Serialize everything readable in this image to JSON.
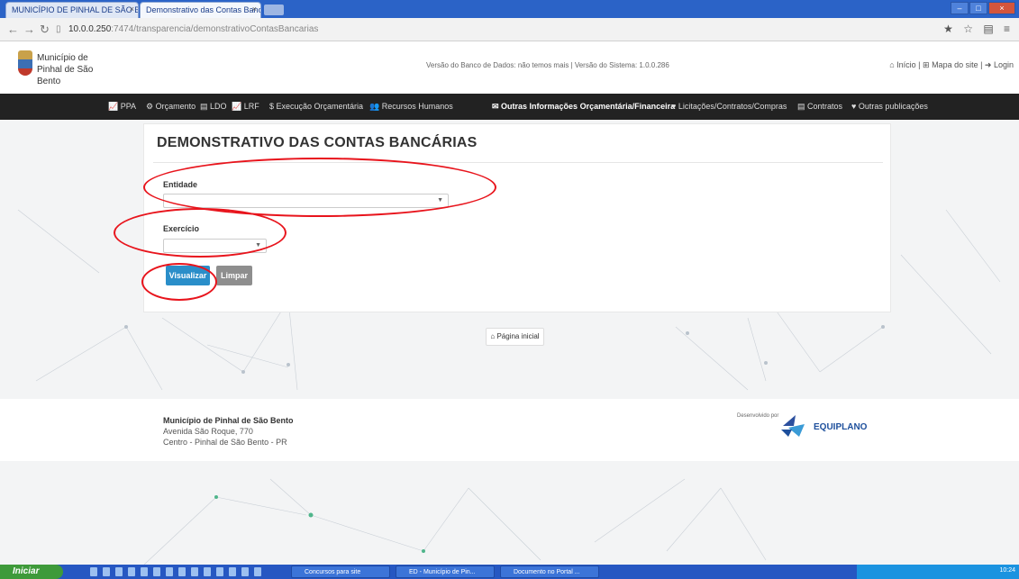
{
  "browser": {
    "tabs": [
      {
        "label": "MUNICÍPIO DE PINHAL DE SÃO BENTO"
      },
      {
        "label": "Demonstrativo das Contas Bancárias"
      }
    ],
    "url_host": "10.0.0.250",
    "url_path": ":7474/transparencia/demonstrativoContasBancarias",
    "tools": "★ ☆ ▤ ≡"
  },
  "site": {
    "municipality": "Município de Pinhal de São Bento",
    "versions": "Versão do Banco de Dados: não temos mais  |  Versão do Sistema: 1.0.0.286",
    "top_links": "⌂ Início  |  ⊞ Mapa do site  |  ➜ Login"
  },
  "nav": {
    "items": [
      {
        "label": "📈 PPA"
      },
      {
        "label": "⚙ Orçamento"
      },
      {
        "label": "▤ LDO"
      },
      {
        "label": "📈 LRF"
      },
      {
        "label": "$ Execução Orçamentária"
      },
      {
        "label": "👥 Recursos Humanos"
      },
      {
        "label": "✉ Outras Informações Orçamentária/Financeira"
      },
      {
        "label": "♥ Licitações/Contratos/Compras"
      },
      {
        "label": "▤ Contratos"
      },
      {
        "label": "♥ Outras publicações"
      }
    ]
  },
  "form": {
    "title": "DEMONSTRATIVO DAS CONTAS BANCÁRIAS",
    "entidade_label": "Entidade",
    "entidade_value": "",
    "exercicio_label": "Exercício",
    "exercicio_value": "",
    "visualizar_label": "Visualizar",
    "limpar_label": "Limpar"
  },
  "home_button": "⌂ Página inicial",
  "footer": {
    "line1": "Município de Pinhal de São Bento",
    "line2": "Avenida São Roque, 770",
    "line3": "Centro - Pinhal de São Bento - PR",
    "developed_by": "Desenvolvido por",
    "company": "EQUIPLANO"
  },
  "taskbar": {
    "start": "Iniciar",
    "items": [
      {
        "label": "Concursos para site"
      },
      {
        "label": "ED - Município de Pin..."
      },
      {
        "label": "Documento no Portal ..."
      }
    ],
    "clock": "10:24"
  },
  "colors": {
    "accent": "#2a8ec9",
    "annotation": "#e8141c",
    "nav_bg": "#222222"
  }
}
